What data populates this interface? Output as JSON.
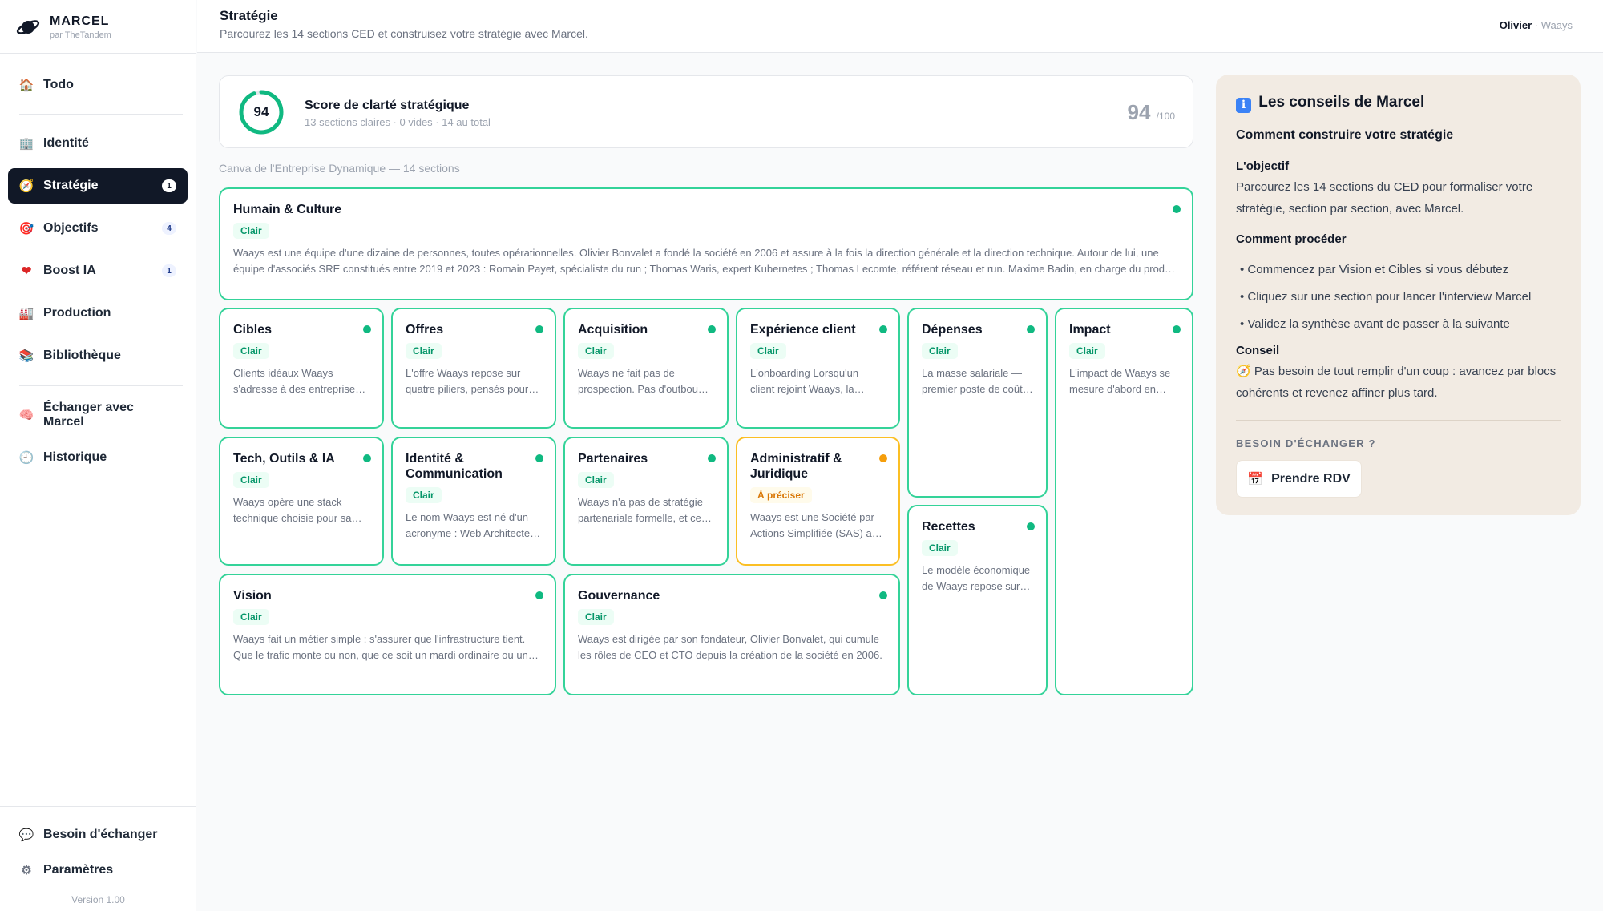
{
  "brand": {
    "name": "MARCEL",
    "sub": "par TheTandem"
  },
  "sidebar": {
    "items": [
      {
        "label": "Todo",
        "icon": "house-icon",
        "glyph": "🏠"
      },
      {
        "label": "Identité",
        "icon": "building-icon",
        "glyph": "🏢"
      },
      {
        "label": "Stratégie",
        "icon": "compass-icon",
        "glyph": "🧭",
        "badge": "1"
      },
      {
        "label": "Objectifs",
        "icon": "target-icon",
        "glyph": "🎯",
        "badge": "4"
      },
      {
        "label": "Boost IA",
        "icon": "heart-icon",
        "glyph": "❤",
        "badge": "1"
      },
      {
        "label": "Production",
        "icon": "factory-icon",
        "glyph": "🏭"
      },
      {
        "label": "Bibliothèque",
        "icon": "books-icon",
        "glyph": "📚"
      },
      {
        "label": "Échanger avec Marcel",
        "icon": "brain-icon",
        "glyph": "🧠"
      },
      {
        "label": "Historique",
        "icon": "clock-icon",
        "glyph": "🕘"
      }
    ],
    "bottom": [
      {
        "label": "Besoin d'échanger",
        "icon": "speech-bubble-icon",
        "glyph": "💬"
      },
      {
        "label": "Paramètres",
        "icon": "gear-icon",
        "glyph": "⚙"
      }
    ],
    "version": "Version 1.00"
  },
  "header": {
    "title": "Stratégie",
    "subtitle": "Parcourez les 14 sections CED et construisez votre stratégie avec Marcel.",
    "user": "Olivier",
    "org": "· Waays"
  },
  "score": {
    "value": "94",
    "fraction": 0.94,
    "title": "Score de clarté stratégique",
    "meta": "13 sections claires · 0 vides · 14 au total",
    "big": "94",
    "max": "/100"
  },
  "canvas_caption": "Canva de l'Entreprise Dynamique — 14 sections",
  "colors": {
    "accent": "#10b981",
    "warning": "#f59e0b",
    "active_nav": "#111827",
    "panel": "#f2ebe3"
  },
  "sections": {
    "humain": {
      "title": "Humain & Culture",
      "status": "Clair",
      "text": "Waays est une équipe d'une dizaine de personnes, toutes opérationnelles. Olivier Bonvalet a fondé la société en 2006 et assure à la fois la direction générale et la direction technique. Autour de lui, une équipe d'associés SRE constitués entre 2019 et 2023 : Romain Payet, spécialiste du run ; Thomas Waris, expert Kubernetes ; Thomas Lecomte, référent réseau et run. Maxime Badin, en charge du produit et de l'expérience client."
    },
    "cibles": {
      "title": "Cibles",
      "status": "Clair",
      "text": "Clients idéaux Waays s'adresse à des entreprises dont l'infrastructure est critique."
    },
    "offres": {
      "title": "Offres",
      "status": "Clair",
      "text": "L'offre Waays repose sur quatre piliers, pensés pour accompagner nos clients."
    },
    "acquisition": {
      "title": "Acquisition",
      "status": "Clair",
      "text": "Waays ne fait pas de prospection. Pas d'outbound, pas de campagnes."
    },
    "experience": {
      "title": "Expérience client",
      "status": "Clair",
      "text": "L'onboarding Lorsqu'un client rejoint Waays, la première étape est un audit."
    },
    "depenses": {
      "title": "Dépenses",
      "status": "Clair",
      "text": "La masse salariale — premier poste de coût de l'entreprise."
    },
    "impact": {
      "title": "Impact",
      "status": "Clair",
      "text": "L'impact de Waays se mesure d'abord en disponibilité."
    },
    "tech": {
      "title": "Tech, Outils & IA",
      "status": "Clair",
      "text": "Waays opère une stack technique choisie pour sa robustesse."
    },
    "identite": {
      "title": "Identité & Communication",
      "status": "Clair",
      "text": "Le nom Waays est né d'un acronyme : Web Architecte As You Scale."
    },
    "partenaires": {
      "title": "Partenaires",
      "status": "Clair",
      "text": "Waays n'a pas de stratégie partenariale formelle, et ce choix est assumé."
    },
    "admin": {
      "title": "Administratif & Juridique",
      "status": "À préciser",
      "text": "Waays est une Société par Actions Simplifiée (SAS) au capital de."
    },
    "recettes": {
      "title": "Recettes",
      "status": "Clair",
      "text": "Le modèle économique de Waays repose sur l'infogérance."
    },
    "vision": {
      "title": "Vision",
      "status": "Clair",
      "text": "Waays fait un métier simple : s'assurer que l'infrastructure tient. Que le trafic monte ou non, que ce soit un mardi ordinaire ou un jour de pic."
    },
    "gouvernance": {
      "title": "Gouvernance",
      "status": "Clair",
      "text": "Waays est dirigée par son fondateur, Olivier Bonvalet, qui cumule les rôles de CEO et CTO depuis la création de la société en 2006."
    }
  },
  "tips": {
    "title": "Les conseils de Marcel",
    "icon": "info-icon",
    "heading": "Comment construire votre stratégie",
    "objective_title": "L'objectif",
    "objective_text": "Parcourez les 14 sections du CED pour formaliser votre stratégie, section par section, avec Marcel.",
    "how_title": "Comment procéder",
    "steps": [
      "• Commencez par Vision et Cibles si vous débutez",
      "• Cliquez sur une section pour lancer l'interview Marcel",
      "• Validez la synthèse avant de passer à la suivante"
    ],
    "advice_title": "Conseil",
    "advice_text": "Pas besoin de tout remplir d'un coup : avancez par blocs cohérents et revenez affiner plus tard.",
    "need_label": "BESOIN D'ÉCHANGER ?",
    "rdv_label": "Prendre RDV"
  }
}
